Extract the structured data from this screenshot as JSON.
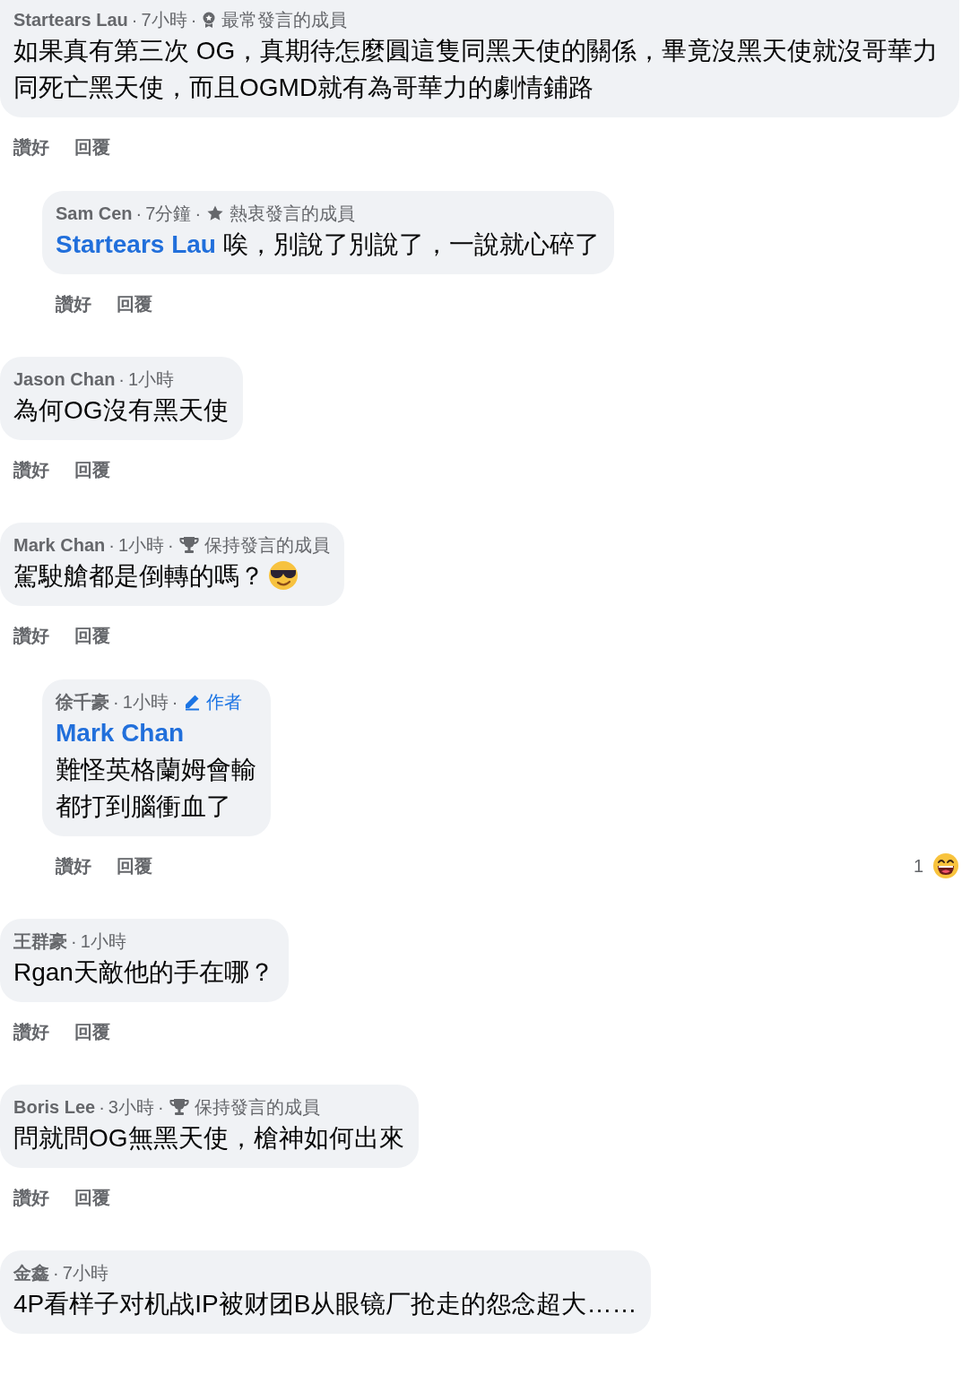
{
  "separator": "·",
  "comments": [
    {
      "author": "Startears Lau",
      "time": "7小時",
      "badge": {
        "kind": "top",
        "label": "最常發言的成員"
      },
      "text": "如果真有第三次 OG，真期待怎麼圓這隻同黑天使的關係，畢竟沒黑天使就沒哥華力同死亡黑天使，而且OGMD就有為哥華力的劇情鋪路",
      "actions": [
        "讚好",
        "回覆"
      ],
      "replies": [
        {
          "author": "Sam Cen",
          "time": "7分鐘",
          "badge": {
            "kind": "rising",
            "label": "熱衷發言的成員"
          },
          "mention": "Startears Lau",
          "text": "唉，別說了別說了，一說就心碎了",
          "actions": [
            "讚好",
            "回覆"
          ]
        }
      ]
    },
    {
      "author": "Jason Chan",
      "time": "1小時",
      "text": "為何OG沒有黑天使",
      "actions": [
        "讚好",
        "回覆"
      ]
    },
    {
      "author": "Mark Chan",
      "time": "1小時",
      "badge": {
        "kind": "conversation",
        "label": "保持發言的成員"
      },
      "text": "駕駛艙都是倒轉的嗎？",
      "has_emoji": true,
      "actions": [
        "讚好",
        "回覆"
      ],
      "replies": [
        {
          "author": "徐千豪",
          "time": "1小時",
          "badge": {
            "kind": "author",
            "label": "作者"
          },
          "mention": "Mark Chan",
          "mention_on_own_line": true,
          "lines": [
            "難怪英格蘭姆會輸",
            "都打到腦衝血了"
          ],
          "actions": [
            "讚好",
            "回覆"
          ],
          "reactions": {
            "count": "1"
          }
        }
      ]
    },
    {
      "author": "王群豪",
      "time": "1小時",
      "text": "Rgan天敵他的手在哪？",
      "actions": [
        "讚好",
        "回覆"
      ]
    },
    {
      "author": "Boris Lee",
      "time": "3小時",
      "badge": {
        "kind": "conversation",
        "label": "保持發言的成員"
      },
      "text": "問就問OG無黑天使，槍神如何出來",
      "actions": [
        "讚好",
        "回覆"
      ]
    },
    {
      "author": "金鑫",
      "time": "7小時",
      "text": "4P看样子对机战IP被财团B从眼镜厂抢走的怨念超大……"
    }
  ]
}
